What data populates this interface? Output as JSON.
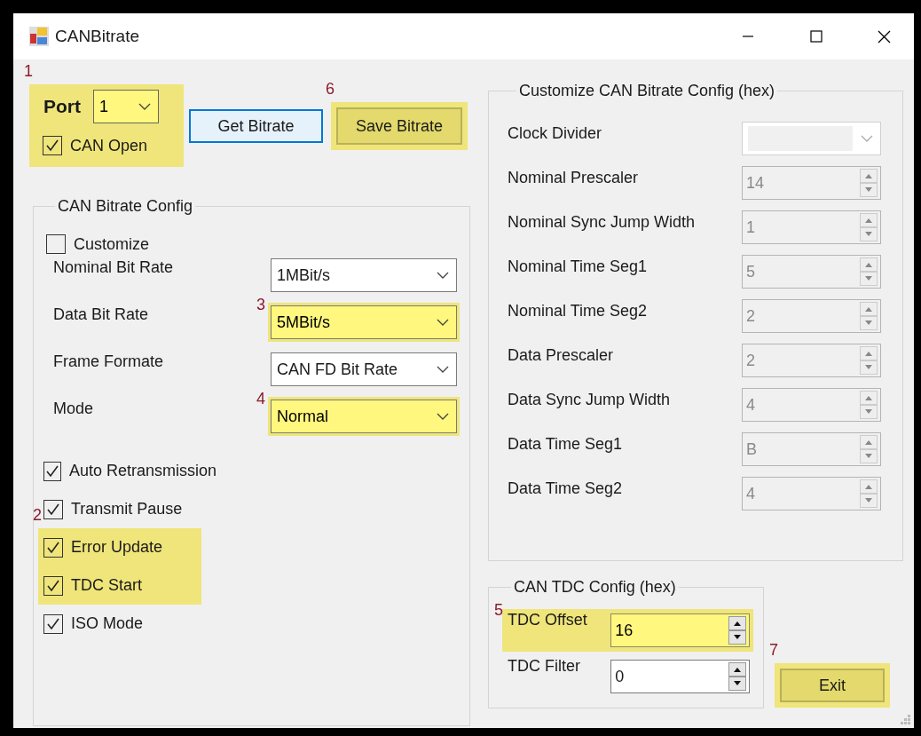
{
  "window": {
    "title": "CANBitrate"
  },
  "port_group": {
    "label": "Port",
    "value": "1",
    "highlighted": true,
    "marker": "1",
    "can_open": {
      "label": "CAN Open",
      "checked": true
    }
  },
  "buttons": [
    {
      "label": "Get Bitrate",
      "focused": true,
      "highlighted": false
    },
    {
      "label": "Save Bitrate",
      "focused": false,
      "highlighted": true,
      "marker": "6"
    }
  ],
  "bitrate_config": {
    "title": "CAN Bitrate Config",
    "customize": {
      "label": "Customize",
      "checked": false
    },
    "fields": [
      {
        "label": "Nominal Bit Rate",
        "value": "1MBit/s",
        "highlighted": false
      },
      {
        "label": "Data Bit Rate",
        "value": "5MBit/s",
        "highlighted": true,
        "marker": "3"
      },
      {
        "label": "Frame Formate",
        "value": "CAN FD Bit Rate",
        "highlighted": false
      },
      {
        "label": "Mode",
        "value": "Normal",
        "highlighted": true,
        "marker": "4"
      }
    ],
    "options": [
      {
        "label": "Auto Retransmission",
        "checked": true,
        "highlighted": false
      },
      {
        "label": "Transmit Pause",
        "checked": true,
        "highlighted": false
      },
      {
        "label": "Error Update",
        "checked": true,
        "highlighted": true,
        "marker": "2"
      },
      {
        "label": "TDC Start",
        "checked": true,
        "highlighted": true
      },
      {
        "label": "ISO Mode",
        "checked": true,
        "highlighted": false
      }
    ]
  },
  "custom_config": {
    "title": "Customize CAN Bitrate Config (hex)",
    "fields": [
      {
        "label": "Clock Divider",
        "kind": "combo",
        "disabled": true
      },
      {
        "label": "Nominal Prescaler",
        "kind": "spin",
        "value": "14",
        "disabled": true
      },
      {
        "label": "Nominal Sync Jump Width",
        "kind": "spin",
        "value": "1",
        "disabled": true
      },
      {
        "label": "Nominal Time Seg1",
        "kind": "spin",
        "value": "5",
        "disabled": true
      },
      {
        "label": "Nominal Time Seg2",
        "kind": "spin",
        "value": "2",
        "disabled": true
      },
      {
        "label": "Data Prescaler",
        "kind": "spin",
        "value": "2",
        "disabled": true
      },
      {
        "label": "Data Sync Jump Width",
        "kind": "spin",
        "value": "4",
        "disabled": true
      },
      {
        "label": "Data Time Seg1",
        "kind": "spin",
        "value": "B",
        "disabled": true
      },
      {
        "label": "Data Time Seg2",
        "kind": "spin",
        "value": "4",
        "disabled": true
      }
    ]
  },
  "tdc_config": {
    "title": "CAN TDC Config (hex)",
    "fields": [
      {
        "label": "TDC Offset",
        "value": "16",
        "highlighted": true,
        "marker": "5"
      },
      {
        "label": "TDC Filter",
        "value": "0",
        "highlighted": false
      }
    ]
  },
  "exit_button": {
    "label": "Exit",
    "highlighted": true,
    "marker": "7"
  }
}
